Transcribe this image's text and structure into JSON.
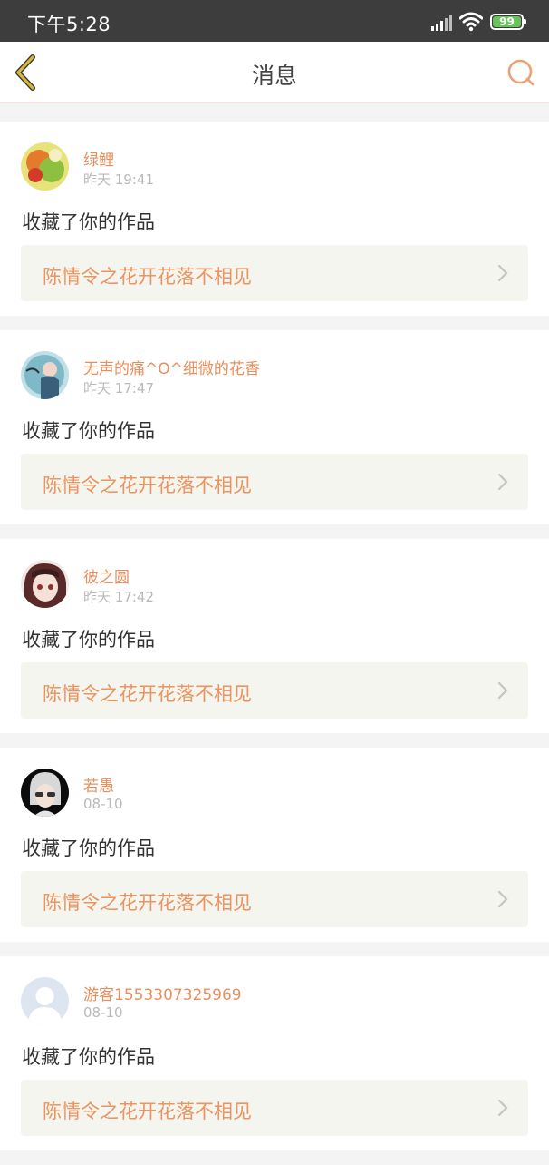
{
  "status_bar": {
    "time": "下午5:28",
    "battery": "99"
  },
  "header": {
    "title": "消息"
  },
  "messages": [
    {
      "username": "绿鲤",
      "time": "昨天 19:41",
      "action": "收藏了你的作品",
      "work_title": "陈情令之花开花落不相见"
    },
    {
      "username": "无声的痛^O^细微的花香",
      "time": "昨天 17:47",
      "action": "收藏了你的作品",
      "work_title": "陈情令之花开花落不相见"
    },
    {
      "username": "彼之圆",
      "time": "昨天 17:42",
      "action": "收藏了你的作品",
      "work_title": "陈情令之花开花落不相见"
    },
    {
      "username": "若愚",
      "time": "08-10",
      "action": "收藏了你的作品",
      "work_title": "陈情令之花开花落不相见"
    },
    {
      "username": "游客1553307325969",
      "time": "08-10",
      "action": "收藏了你的作品",
      "work_title": "陈情令之花开花落不相见"
    }
  ],
  "colors": {
    "accent": "#e98f5d",
    "back_icon": "#d4b83a",
    "statusbar": "#3d3d3d"
  }
}
